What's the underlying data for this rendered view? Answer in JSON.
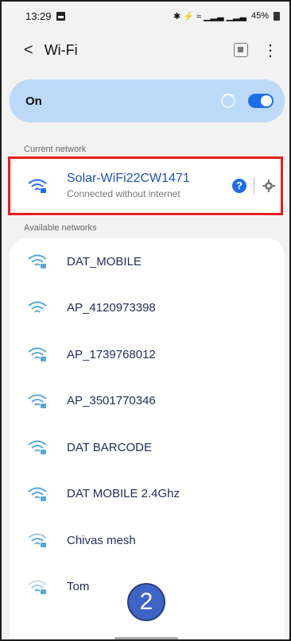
{
  "status_bar": {
    "time": "13:29",
    "battery": "45%",
    "signals": "✱ ⚡ ≈ ▁▂▃ ▁▂▃"
  },
  "header": {
    "back_label": "<",
    "title": "Wi-Fi",
    "more_label": "⋮"
  },
  "toggle_bar": {
    "label": "On",
    "state": "on"
  },
  "current": {
    "section_label": "Current network",
    "name": "Solar-WiFi22CW1471",
    "status": "Connected without internet",
    "help_label": "?"
  },
  "available": {
    "section_label": "Available networks",
    "networks": [
      {
        "name": "DAT_MOBILE",
        "locked": true
      },
      {
        "name": "AP_4120973398",
        "locked": false
      },
      {
        "name": "AP_1739768012",
        "locked": true
      },
      {
        "name": "AP_3501770346",
        "locked": true
      },
      {
        "name": "DAT BARCODE",
        "locked": true
      },
      {
        "name": "DAT MOBILE 2.4Ghz",
        "locked": true
      },
      {
        "name": "Chivas mesh",
        "locked": true
      },
      {
        "name": "Tom",
        "locked": true
      }
    ]
  },
  "annotation": {
    "number": "2"
  },
  "colors": {
    "accent": "#1f6de6",
    "highlight": "#e51f1f",
    "toggle_bar": "#bcd9f8",
    "badge": "#3e64c5"
  }
}
